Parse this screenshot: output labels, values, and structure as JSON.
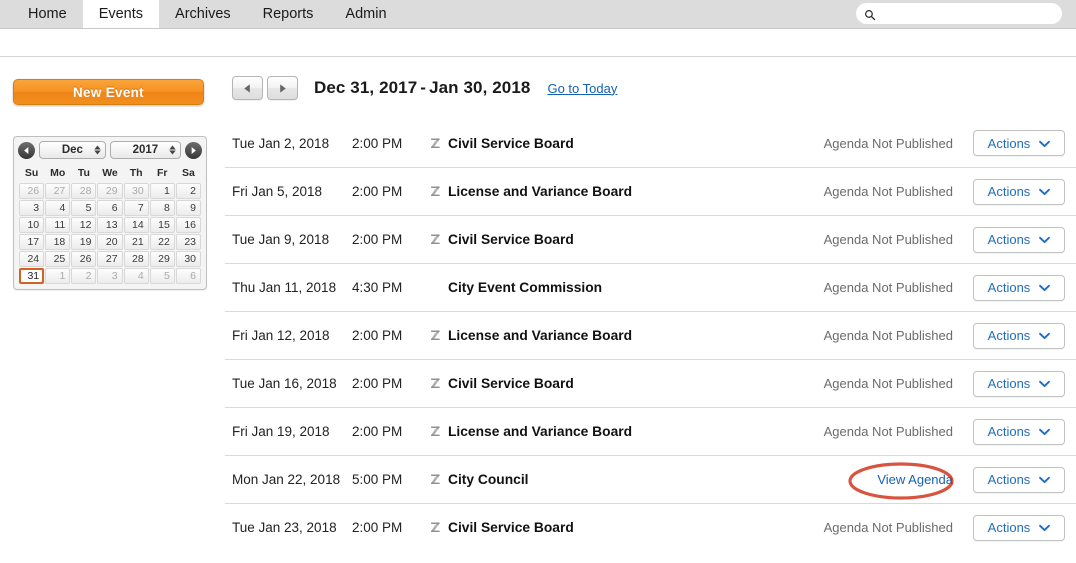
{
  "nav": {
    "tabs": [
      {
        "label": "Home",
        "active": false
      },
      {
        "label": "Events",
        "active": true
      },
      {
        "label": "Archives",
        "active": false
      },
      {
        "label": "Reports",
        "active": false
      },
      {
        "label": "Admin",
        "active": false
      }
    ],
    "search": {
      "value": "",
      "placeholder": "",
      "icon": "search-icon"
    }
  },
  "sidebar": {
    "new_event_label": "New Event",
    "calendar": {
      "month": "Dec",
      "year": "2017",
      "prev_icon": "chevron-left-icon",
      "next_icon": "chevron-right-icon",
      "weekdays": [
        "Su",
        "Mo",
        "Tu",
        "We",
        "Th",
        "Fr",
        "Sa"
      ],
      "selected_day": "31",
      "weeks": [
        [
          {
            "d": "26",
            "other": true
          },
          {
            "d": "27",
            "other": true
          },
          {
            "d": "28",
            "other": true
          },
          {
            "d": "29",
            "other": true
          },
          {
            "d": "30",
            "other": true
          },
          {
            "d": "1",
            "other": false
          },
          {
            "d": "2",
            "other": false
          }
        ],
        [
          {
            "d": "3",
            "other": false
          },
          {
            "d": "4",
            "other": false
          },
          {
            "d": "5",
            "other": false
          },
          {
            "d": "6",
            "other": false
          },
          {
            "d": "7",
            "other": false
          },
          {
            "d": "8",
            "other": false
          },
          {
            "d": "9",
            "other": false
          }
        ],
        [
          {
            "d": "10",
            "other": false
          },
          {
            "d": "11",
            "other": false
          },
          {
            "d": "12",
            "other": false
          },
          {
            "d": "13",
            "other": false
          },
          {
            "d": "14",
            "other": false
          },
          {
            "d": "15",
            "other": false
          },
          {
            "d": "16",
            "other": false
          }
        ],
        [
          {
            "d": "17",
            "other": false
          },
          {
            "d": "18",
            "other": false
          },
          {
            "d": "19",
            "other": false
          },
          {
            "d": "20",
            "other": false
          },
          {
            "d": "21",
            "other": false
          },
          {
            "d": "22",
            "other": false
          },
          {
            "d": "23",
            "other": false
          }
        ],
        [
          {
            "d": "24",
            "other": false
          },
          {
            "d": "25",
            "other": false
          },
          {
            "d": "26",
            "other": false
          },
          {
            "d": "27",
            "other": false
          },
          {
            "d": "28",
            "other": false
          },
          {
            "d": "29",
            "other": false
          },
          {
            "d": "30",
            "other": false
          }
        ],
        [
          {
            "d": "31",
            "other": false,
            "selected": true
          },
          {
            "d": "1",
            "other": true
          },
          {
            "d": "2",
            "other": true
          },
          {
            "d": "3",
            "other": true
          },
          {
            "d": "4",
            "other": true
          },
          {
            "d": "5",
            "other": true
          },
          {
            "d": "6",
            "other": true
          }
        ]
      ]
    }
  },
  "main": {
    "prev_icon": "triangle-left-icon",
    "next_icon": "triangle-right-icon",
    "range_start": "Dec 31, 2017",
    "range_dash": "-",
    "range_end": "Jan 30, 2018",
    "today_link": "Go to Today",
    "actions_label": "Actions",
    "actions_icon": "chevron-down-icon",
    "media_icon": "media-recording-icon",
    "events": [
      {
        "date": "Tue Jan 2, 2018",
        "time": "2:00 PM",
        "title": "Civil Service Board",
        "has_icon": true,
        "status": "Agenda Not Published",
        "link": null,
        "annotated": false
      },
      {
        "date": "Fri Jan 5, 2018",
        "time": "2:00 PM",
        "title": "License and Variance Board",
        "has_icon": true,
        "status": "Agenda Not Published",
        "link": null,
        "annotated": false
      },
      {
        "date": "Tue Jan 9, 2018",
        "time": "2:00 PM",
        "title": "Civil Service Board",
        "has_icon": true,
        "status": "Agenda Not Published",
        "link": null,
        "annotated": false
      },
      {
        "date": "Thu Jan 11, 2018",
        "time": "4:30 PM",
        "title": "City Event Commission",
        "has_icon": false,
        "status": "Agenda Not Published",
        "link": null,
        "annotated": false
      },
      {
        "date": "Fri Jan 12, 2018",
        "time": "2:00 PM",
        "title": "License and Variance Board",
        "has_icon": true,
        "status": "Agenda Not Published",
        "link": null,
        "annotated": false
      },
      {
        "date": "Tue Jan 16, 2018",
        "time": "2:00 PM",
        "title": "Civil Service Board",
        "has_icon": true,
        "status": "Agenda Not Published",
        "link": null,
        "annotated": false
      },
      {
        "date": "Fri Jan 19, 2018",
        "time": "2:00 PM",
        "title": "License and Variance Board",
        "has_icon": true,
        "status": "Agenda Not Published",
        "link": null,
        "annotated": false
      },
      {
        "date": "Mon Jan 22, 2018",
        "time": "5:00 PM",
        "title": "City Council",
        "has_icon": true,
        "status": null,
        "link": "View Agenda",
        "annotated": true
      },
      {
        "date": "Tue Jan 23, 2018",
        "time": "2:00 PM",
        "title": "Civil Service Board",
        "has_icon": true,
        "status": "Agenda Not Published",
        "link": null,
        "annotated": false
      }
    ]
  },
  "colors": {
    "nav_bg": "#dcdcdc",
    "accent_orange": "#f08a1a",
    "link_blue": "#1562b5",
    "annotation_red": "#d9543f",
    "selected_day_border": "#d4621e"
  }
}
